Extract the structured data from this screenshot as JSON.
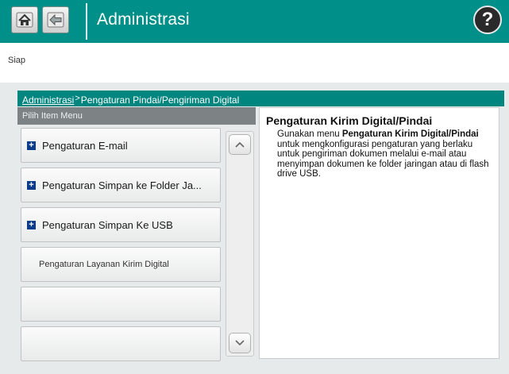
{
  "header": {
    "title": "Administrasi",
    "help_label": "?",
    "home_icon": "home-icon",
    "back_icon": "back-arrow-icon",
    "accent_color": "#009089"
  },
  "status": {
    "text": "Siap"
  },
  "breadcrumb": {
    "root": "Administrasi",
    "separator": ">",
    "current": "Pengaturan Pindai/Pengiriman Digital"
  },
  "menu": {
    "header": "Pilih Item Menu",
    "items": [
      {
        "label": "Pengaturan E-mail",
        "expandable": true
      },
      {
        "label": "Pengaturan Simpan ke Folder Ja...",
        "expandable": true
      },
      {
        "label": "Pengaturan Simpan Ke USB",
        "expandable": true
      },
      {
        "label": "Pengaturan Layanan Kirim Digital",
        "expandable": false
      },
      {
        "label": "",
        "expandable": false
      },
      {
        "label": "",
        "expandable": false
      }
    ]
  },
  "description": {
    "title": "Pengaturan Kirim Digital/Pindai",
    "text_before": "Gunakan menu ",
    "text_bold": "Pengaturan Kirim Digital/Pindai",
    "text_after": " untuk mengkonfigurasi pengaturan yang berlaku untuk pengiriman dokumen melalui e-mail atau menyimpan dokumen ke folder jaringan atau di flash drive USB."
  }
}
